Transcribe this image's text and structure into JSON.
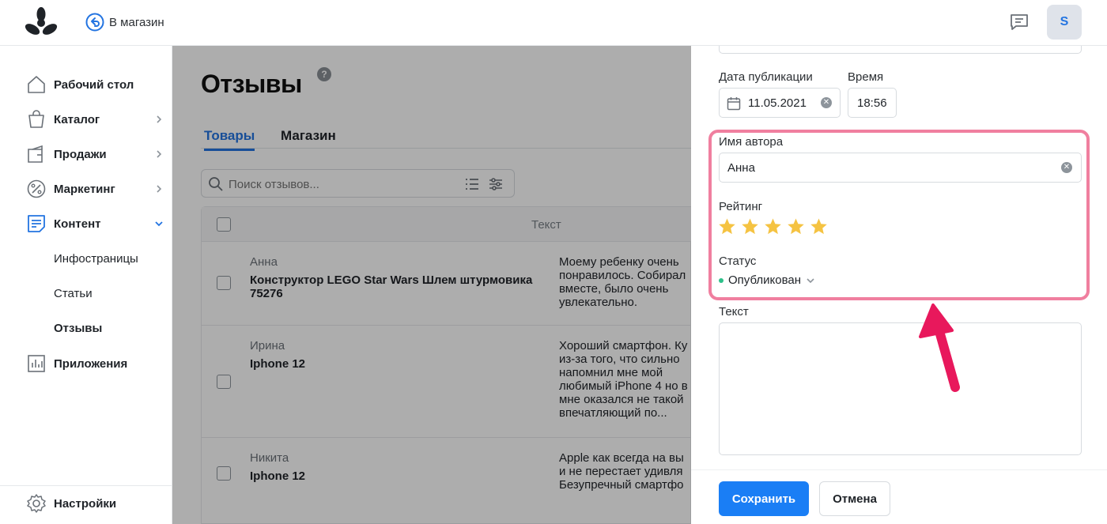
{
  "header": {
    "back_label": "В магазин",
    "avatar_letter": "S"
  },
  "sidebar": {
    "items": [
      {
        "label": "Рабочий стол",
        "icon": "home-icon"
      },
      {
        "label": "Каталог",
        "icon": "bag-icon"
      },
      {
        "label": "Продажи",
        "icon": "sales-icon"
      },
      {
        "label": "Маркетинг",
        "icon": "percent-icon"
      },
      {
        "label": "Контент",
        "icon": "content-icon"
      },
      {
        "label": "Приложения",
        "icon": "apps-icon"
      }
    ],
    "sub_items": [
      "Инфостраницы",
      "Статьи",
      "Отзывы"
    ],
    "active_sub": "Отзывы",
    "settings_label": "Настройки"
  },
  "main": {
    "title": "Отзывы",
    "help": "?",
    "tabs": [
      "Товары",
      "Магазин"
    ],
    "search_placeholder": "Поиск отзывов...",
    "table_header_text": "Текст",
    "rows": [
      {
        "author": "Анна",
        "product": "Конструктор LEGO Star Wars Шлем штурмовика 75276",
        "text": "Моему ребенку очень\nпонравилось. Собирал\nвместе, было очень\nувлекательно."
      },
      {
        "author": "Ирина",
        "product": "Iphone 12",
        "text": "Хороший смартфон. Ку\nиз-за того, что сильно\nнапомнил мне мой\nлюбимый iPhone 4 но в\nмне оказался не такой\nвпечатляющий по..."
      },
      {
        "author": "Никита",
        "product": "Iphone 12",
        "text": "Apple как всегда на вы\nи не перестает удивля\nБезупречный смартфо"
      }
    ]
  },
  "panel": {
    "date_label": "Дата публикации",
    "date_value": "11.05.2021",
    "time_label": "Время",
    "time_value": "18:56",
    "author_label": "Имя автора",
    "author_value": "Анна",
    "rating_label": "Рейтинг",
    "rating_value": 5,
    "rating_max": 5,
    "status_label": "Статус",
    "status_value": "Опубликован",
    "text_label": "Текст",
    "text_value": "",
    "save_label": "Сохранить",
    "cancel_label": "Отмена"
  },
  "colors": {
    "accent": "#1a7ef5",
    "highlight": "#f07f9f",
    "arrow": "#e8185c",
    "star": "#f5c342",
    "status_dot": "#2dc089"
  }
}
